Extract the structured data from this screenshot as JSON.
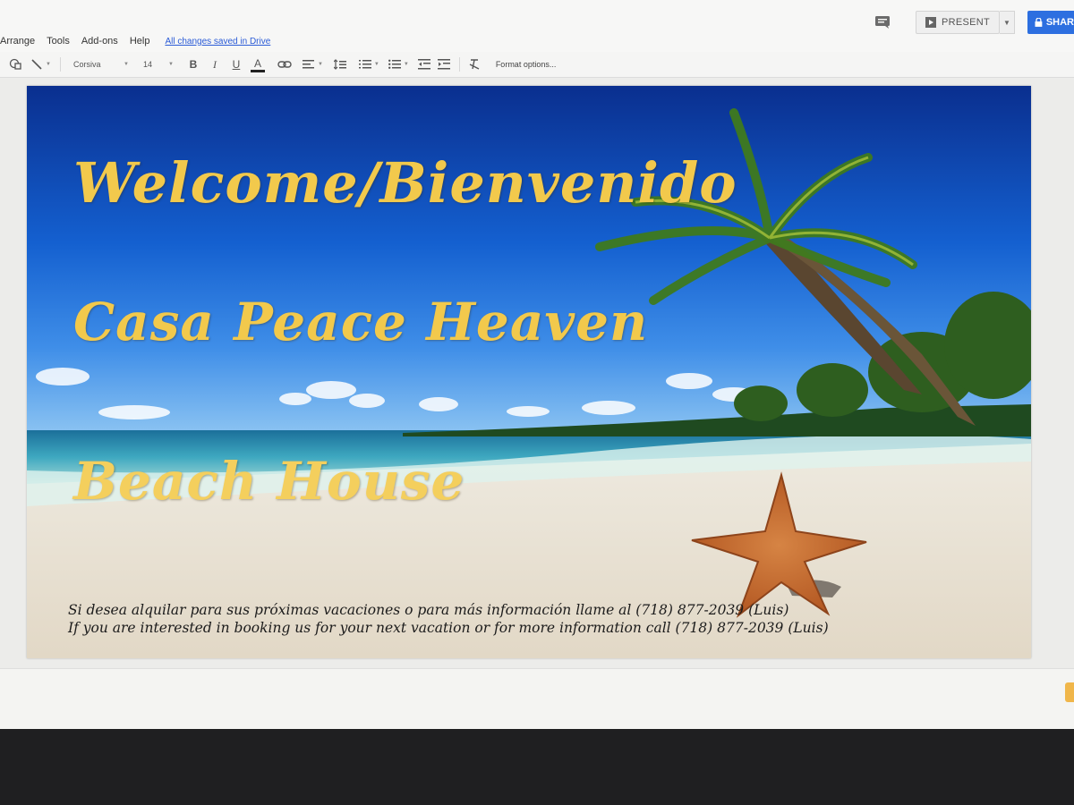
{
  "menu": {
    "items": [
      "Arrange",
      "Tools",
      "Add-ons",
      "Help"
    ],
    "save_status": "All changes saved in Drive"
  },
  "header": {
    "present_label": "PRESENT",
    "share_label": "SHAR"
  },
  "toolbar": {
    "font_name": "Corsiva",
    "font_size": "14",
    "bold": "B",
    "italic": "I",
    "underline": "U",
    "text_color": "A",
    "format_options": "Format options..."
  },
  "slide": {
    "title_line1": "Welcome/Bienvenido",
    "title_line2": "Casa Peace Heaven",
    "title_line3": "Beach House",
    "info_es": "Si desea alquilar para sus próximas vacaciones o para más información llame al (718) 877-2039 (Luis)",
    "info_en": "If you are interested in booking us for your next vacation or for more information call (718) 877-2039 (Luis)"
  },
  "colors": {
    "title_yellow": "#f2c94c",
    "share_blue": "#2d6fe0"
  }
}
